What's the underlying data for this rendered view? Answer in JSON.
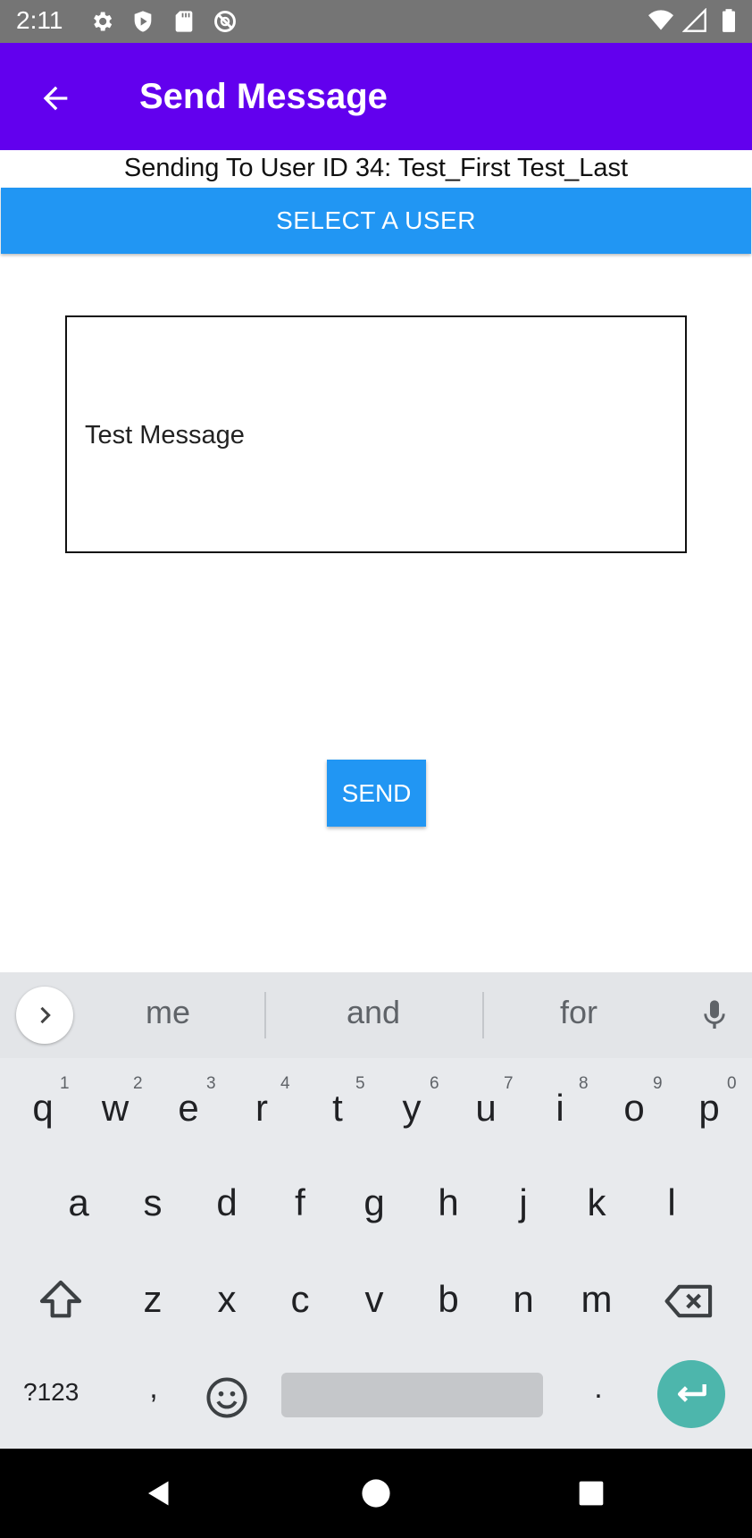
{
  "status_bar": {
    "time": "2:11",
    "left_icons": [
      "gear-icon",
      "shield-icon",
      "sd-card-icon",
      "at-sign-icon"
    ],
    "right_icons": [
      "wifi-icon",
      "signal-icon",
      "battery-icon"
    ]
  },
  "app_bar": {
    "title": "Send Message",
    "back_icon": "arrow-back-icon",
    "background": "#6200ee"
  },
  "recipient": {
    "text": "Sending To User ID 34: Test_First Test_Last"
  },
  "select_user_button": {
    "label": "SELECT A USER",
    "color": "#2196f3"
  },
  "message_input": {
    "value": "Test Message"
  },
  "send_button": {
    "label": "SEND",
    "color": "#2196f3"
  },
  "keyboard": {
    "suggestions": [
      "me",
      "and",
      "for"
    ],
    "row1": [
      "q",
      "w",
      "e",
      "r",
      "t",
      "y",
      "u",
      "i",
      "o",
      "p"
    ],
    "row1_numbers": [
      "1",
      "2",
      "3",
      "4",
      "5",
      "6",
      "7",
      "8",
      "9",
      "0"
    ],
    "row2": [
      "a",
      "s",
      "d",
      "f",
      "g",
      "h",
      "j",
      "k",
      "l"
    ],
    "row3": [
      "z",
      "x",
      "c",
      "v",
      "b",
      "n",
      "m"
    ],
    "symbols_key": "?123",
    "comma_key": ",",
    "period_key": ".",
    "enter_color": "#4db6ac"
  },
  "nav_bar": {
    "items": [
      "back-triangle-icon",
      "home-circle-icon",
      "recents-square-icon"
    ]
  }
}
